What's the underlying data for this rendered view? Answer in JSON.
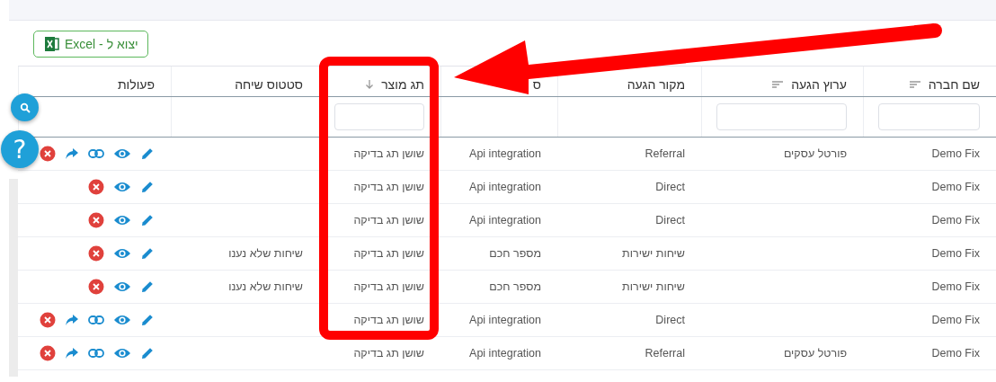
{
  "export_button": {
    "label": "יצוא ל - Excel"
  },
  "table": {
    "columns": [
      {
        "label": "שם חברה",
        "kind": "sortable",
        "filter_field": true
      },
      {
        "label": "ערוץ הגעה",
        "kind": "sortable",
        "filter_field": true
      },
      {
        "label": "מקור הגעה",
        "kind": "plain",
        "filter_field": false
      },
      {
        "label": "ס",
        "kind": "plain",
        "filter_field": false
      },
      {
        "label": "תג מוצר",
        "kind": "sorted",
        "filter_field": true
      },
      {
        "label": "סטטוס שיחה",
        "kind": "plain",
        "filter_field": false
      },
      {
        "label": "פעולות",
        "kind": "plain",
        "filter_field": false
      }
    ],
    "rows": [
      {
        "cells": [
          "Demo Fix",
          "פורטל עסקים",
          "Referral",
          "Api integration",
          "שושן תג בדיקה",
          ""
        ],
        "actions": [
          {
            "kind": "edit"
          },
          {
            "kind": "view"
          },
          {
            "kind": "link"
          },
          {
            "kind": "share"
          },
          {
            "kind": "delete"
          }
        ]
      },
      {
        "cells": [
          "Demo Fix",
          "",
          "Direct",
          "Api integration",
          "שושן תג בדיקה",
          ""
        ],
        "actions": [
          {
            "kind": "edit"
          },
          {
            "kind": "view"
          },
          {
            "kind": "delete"
          }
        ]
      },
      {
        "cells": [
          "Demo Fix",
          "",
          "Direct",
          "Api integration",
          "שושן תג בדיקה",
          ""
        ],
        "actions": [
          {
            "kind": "edit"
          },
          {
            "kind": "view"
          },
          {
            "kind": "delete"
          }
        ]
      },
      {
        "cells": [
          "Demo Fix",
          "",
          "שיחות ישירות",
          "מספר חכם",
          "שושן תג בדיקה",
          "שיחות שלא נענו"
        ],
        "actions": [
          {
            "kind": "edit"
          },
          {
            "kind": "view"
          },
          {
            "kind": "delete"
          }
        ]
      },
      {
        "cells": [
          "Demo Fix",
          "",
          "שיחות ישירות",
          "מספר חכם",
          "שושן תג בדיקה",
          "שיחות שלא נענו"
        ],
        "actions": [
          {
            "kind": "edit"
          },
          {
            "kind": "view"
          },
          {
            "kind": "delete"
          }
        ]
      },
      {
        "cells": [
          "Demo Fix",
          "",
          "Direct",
          "Api integration",
          "שושן תג בדיקה",
          ""
        ],
        "actions": [
          {
            "kind": "edit"
          },
          {
            "kind": "view"
          },
          {
            "kind": "link"
          },
          {
            "kind": "share"
          },
          {
            "kind": "delete"
          }
        ]
      },
      {
        "cells": [
          "Demo Fix",
          "פורטל עסקים",
          "Referral",
          "Api integration",
          "שושן תג בדיקה",
          ""
        ],
        "actions": [
          {
            "kind": "edit"
          },
          {
            "kind": "view"
          },
          {
            "kind": "link"
          },
          {
            "kind": "share"
          },
          {
            "kind": "delete"
          }
        ]
      }
    ]
  },
  "help_button": {
    "label": "?"
  }
}
